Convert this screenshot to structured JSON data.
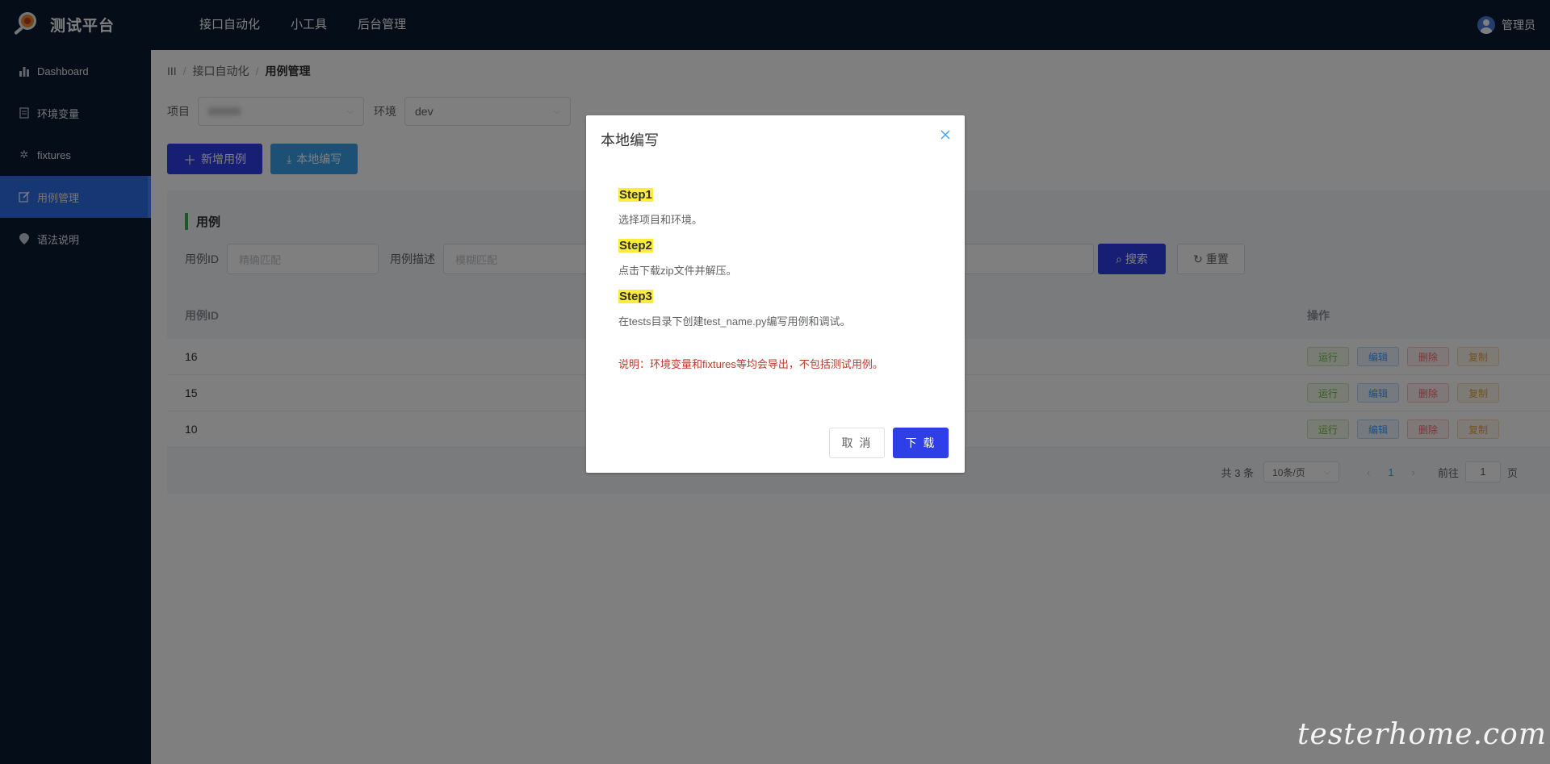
{
  "app": {
    "title": "测试平台"
  },
  "topnav": [
    "接口自动化",
    "小工具",
    "后台管理"
  ],
  "user": {
    "name": "管理员"
  },
  "sidebar": {
    "items": [
      {
        "label": "Dashboard",
        "icon": "bar-chart-icon"
      },
      {
        "label": "环境变量",
        "icon": "document-icon"
      },
      {
        "label": "fixtures",
        "icon": "magic-icon"
      },
      {
        "label": "用例管理",
        "icon": "edit-icon",
        "active": true
      },
      {
        "label": "语法说明",
        "icon": "location-icon"
      }
    ]
  },
  "breadcrumb": {
    "home": "III",
    "parent": "接口自动化",
    "current": "用例管理"
  },
  "filters": {
    "project_label": "项目",
    "env_label": "环境",
    "env_value": "dev"
  },
  "actions": {
    "add": "新增用例",
    "local": "本地编写"
  },
  "card": {
    "title": "用例",
    "id_label": "用例ID",
    "id_placeholder": "精确匹配",
    "desc_label": "用例描述",
    "desc_placeholder": "模糊匹配",
    "search": "搜索",
    "reset": "重置"
  },
  "table": {
    "headers": {
      "id": "用例ID",
      "ops": "操作"
    },
    "rows": [
      {
        "id": "16"
      },
      {
        "id": "15"
      },
      {
        "id": "10"
      }
    ],
    "ops": {
      "run": "运行",
      "edit": "编辑",
      "delete": "删除",
      "copy": "复制"
    }
  },
  "pager": {
    "total": "共 3 条",
    "size": "10条/页",
    "page": "1",
    "goto": "前往",
    "goto_value": "1",
    "page_unit": "页"
  },
  "dialog": {
    "title": "本地编写",
    "steps": [
      {
        "label": "Step1",
        "text": "选择项目和环境。"
      },
      {
        "label": "Step2",
        "text": "点击下载zip文件并解压。"
      },
      {
        "label": "Step3",
        "text": "在tests目录下创建test_name.py编写用例和调试。"
      }
    ],
    "note": "说明：环境变量和fixtures等均会导出，不包括测试用例。",
    "cancel": "取 消",
    "ok": "下 载"
  },
  "watermark": "testerhome.com",
  "colors": {
    "header_bg": "#0b1b33",
    "primary": "#2f3fe8",
    "active_menu": "#2d6ee6",
    "step_highlight": "#ffeb3b"
  }
}
